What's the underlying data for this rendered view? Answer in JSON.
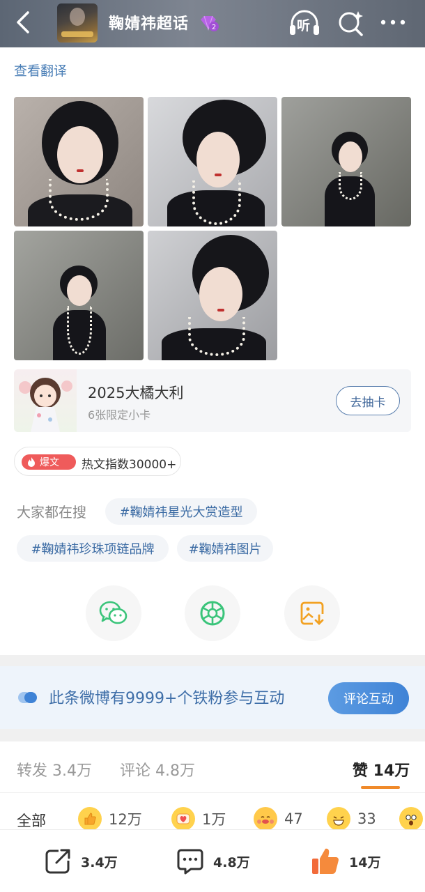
{
  "header": {
    "title": "鞠婧祎超话",
    "listen_label": "听"
  },
  "post": {
    "translate_link": "查看翻译"
  },
  "promo": {
    "title": "2025大橘大利",
    "subtitle": "6张限定小卡",
    "button": "去抽卡"
  },
  "hot": {
    "tag": "爆文",
    "text": "热文指数30000+"
  },
  "search": {
    "label": "大家都在搜",
    "chips": [
      "#鞠婧祎星光大赏造型",
      "#鞠婧祎珍珠项链品牌",
      "#鞠婧祎图片"
    ]
  },
  "fans": {
    "text": "此条微博有9999+个铁粉参与互动",
    "button": "评论互动"
  },
  "tabs": {
    "repost": "转发 3.4万",
    "comment": "评论 4.8万",
    "like": "赞 14万"
  },
  "reactions": {
    "all": "全部",
    "items": [
      {
        "icon": "thumbs-up-emoji",
        "count": "12万"
      },
      {
        "icon": "heart-emoji",
        "count": "1万"
      },
      {
        "icon": "hug-emoji",
        "count": "47"
      },
      {
        "icon": "laugh-emoji",
        "count": "33"
      },
      {
        "icon": "surprised-emoji",
        "count": ""
      }
    ]
  },
  "bottom_bar": {
    "repost_count": "3.4万",
    "comment_count": "4.8万",
    "like_count": "14万"
  },
  "colors": {
    "link": "#4b7fb7",
    "accent_orange": "#f08a2a",
    "hot_red": "#ef5b5b",
    "fans_blue": "#3f83d6"
  }
}
